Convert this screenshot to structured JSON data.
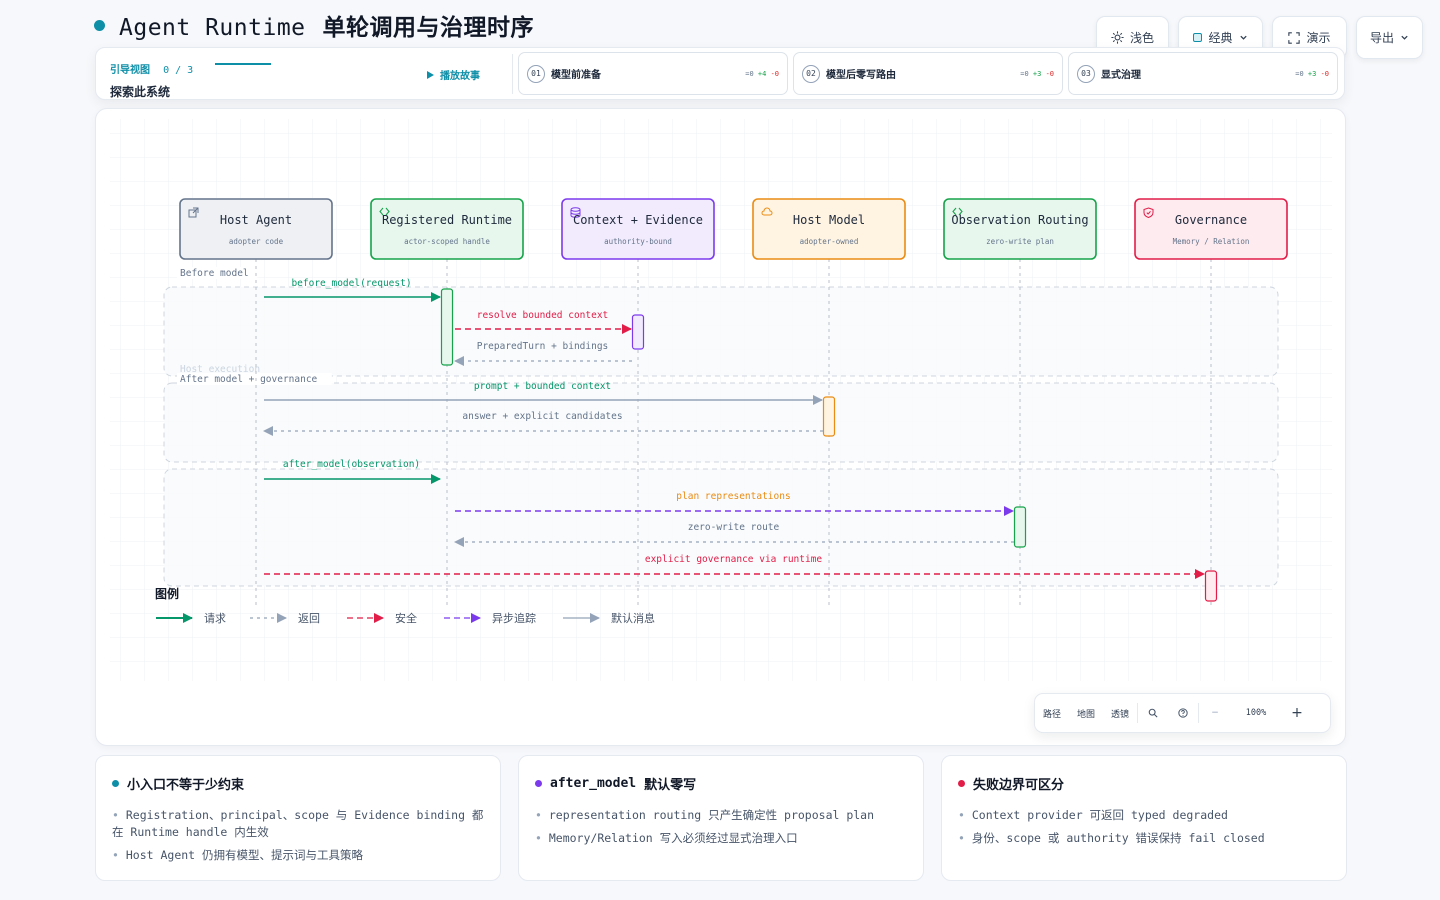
{
  "page": {
    "title_en": "Agent Runtime",
    "title_zh": "单轮调用与治理时序",
    "accent": "#0e8fa8"
  },
  "toolbar": {
    "theme_label": "浅色",
    "theme_icon": "sun-icon",
    "style_label": "经典",
    "present_label": "演示",
    "present_icon": "fullscreen-icon",
    "export_label": "导出"
  },
  "guide": {
    "label": "引导视图",
    "count": "0 / 3",
    "subtitle": "探索此系统",
    "play_label": "播放故事",
    "steps": [
      {
        "num": "01",
        "title": "模型前准备",
        "eq": "=0",
        "plus": "+4",
        "minus": "-0"
      },
      {
        "num": "02",
        "title": "模型后零写路由",
        "eq": "=0",
        "plus": "+3",
        "minus": "-0"
      },
      {
        "num": "03",
        "title": "显式治理",
        "eq": "=0",
        "plus": "+3",
        "minus": "-0"
      }
    ]
  },
  "diagram": {
    "participants": [
      {
        "name": "Host Agent",
        "sub": "adopter code",
        "icon": "external-link-icon",
        "color": "#64748b",
        "fill": "#eef0f4"
      },
      {
        "name": "Registered Runtime",
        "sub": "actor-scoped handle",
        "icon": "code-icon",
        "color": "#16a34a",
        "fill": "#e7f7ee"
      },
      {
        "name": "Context + Evidence",
        "sub": "authority-bound",
        "icon": "database-icon",
        "color": "#7c3aed",
        "fill": "#f1ebfd"
      },
      {
        "name": "Host Model",
        "sub": "adopter-owned",
        "icon": "cloud-icon",
        "color": "#ea8c14",
        "fill": "#fff4e2"
      },
      {
        "name": "Observation Routing",
        "sub": "zero-write plan",
        "icon": "code-icon",
        "color": "#16a34a",
        "fill": "#e7f7ee"
      },
      {
        "name": "Governance",
        "sub": "Memory / Relation",
        "icon": "shield-icon",
        "color": "#e11d48",
        "fill": "#fdebef"
      }
    ],
    "groups": [
      {
        "label": "Before model"
      },
      {
        "label": "Host execution"
      },
      {
        "label": "After model + governance"
      }
    ],
    "messages": [
      {
        "from": 0,
        "to": 1,
        "label": "before_model(request)",
        "kind": "request"
      },
      {
        "from": 1,
        "to": 2,
        "label": "resolve bounded context",
        "kind": "security"
      },
      {
        "from": 2,
        "to": 1,
        "label": "PreparedTurn + bindings",
        "kind": "return"
      },
      {
        "from": 0,
        "to": 3,
        "label": "prompt + bounded context",
        "kind": "default"
      },
      {
        "from": 3,
        "to": 0,
        "label": "answer + explicit candidates",
        "kind": "return"
      },
      {
        "from": 0,
        "to": 1,
        "label": "after_model(observation)",
        "kind": "request"
      },
      {
        "from": 1,
        "to": 4,
        "label": "plan representations",
        "kind": "async"
      },
      {
        "from": 4,
        "to": 1,
        "label": "zero-write route",
        "kind": "return"
      },
      {
        "from": 0,
        "to": 5,
        "label": "explicit governance via runtime",
        "kind": "security"
      }
    ],
    "styles": {
      "request": {
        "color": "#059669",
        "dash": "",
        "label_color": "#059669"
      },
      "return": {
        "color": "#94a3b8",
        "dash": "3 4",
        "label_color": "#64748b"
      },
      "security": {
        "color": "#e11d48",
        "dash": "6 4",
        "label_color": "#e11d48"
      },
      "async": {
        "color": "#7c3aed",
        "dash": "6 4",
        "label_color": "#ea8c14"
      },
      "default": {
        "color": "#94a3b8",
        "dash": "",
        "label_color": "#059669"
      }
    }
  },
  "legend": {
    "title": "图例",
    "items": [
      {
        "kind": "request",
        "label": "请求"
      },
      {
        "kind": "return",
        "label": "返回"
      },
      {
        "kind": "security",
        "label": "安全"
      },
      {
        "kind": "async",
        "label": "异步追踪"
      },
      {
        "kind": "default",
        "label": "默认消息"
      }
    ]
  },
  "zoom": {
    "path_label": "路径",
    "map_label": "地图",
    "lens_label": "透镜",
    "search_icon": "search-icon",
    "help_icon": "help-icon",
    "minus_label": "−",
    "level": "100%",
    "plus_label": "+"
  },
  "cards": [
    {
      "title": "小入口不等于少约束",
      "dot": "#0e8fa8",
      "bullets": [
        "Registration、principal、scope 与 Evidence binding 都在 Runtime handle 内生效",
        "Host Agent 仍拥有模型、提示词与工具策略"
      ]
    },
    {
      "title_code": "after_model",
      "title_rest": "默认零写",
      "dot": "#7c3aed",
      "bullets": [
        "representation routing 只产生确定性 proposal plan",
        "Memory/Relation 写入必须经过显式治理入口"
      ]
    },
    {
      "title": "失败边界可区分",
      "dot": "#e11d48",
      "bullets": [
        "Context provider 可返回 typed degraded",
        "身份、scope 或 authority 错误保持 fail closed"
      ]
    }
  ]
}
